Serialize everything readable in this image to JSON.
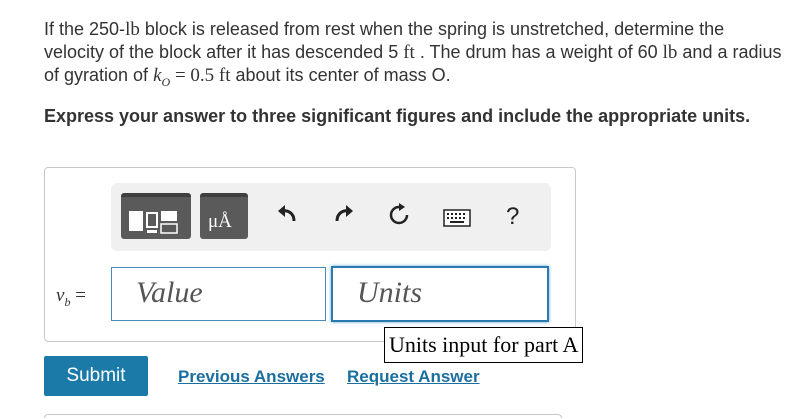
{
  "problem": {
    "text1": "If the 250-",
    "lb1": "lb",
    "text2": " block is released from rest when the spring is unstretched, determine the velocity of the block after it has descended 5 ",
    "ft1": "ft",
    "text3": " . The drum has a weight of 60 ",
    "lb2": "lb",
    "text4": " and a radius of gyration of ",
    "k": "k",
    "ksub": "O",
    "eq": " = 0.5 ",
    "ft2": "ft",
    "text5": " about its center of mass O."
  },
  "instruction": "Express your answer to three significant figures and include the appropriate units.",
  "toolbar": {
    "units_symbol": "μÅ",
    "help_label": "?"
  },
  "answer": {
    "var": "v",
    "var_sub": "b",
    "eq": " =",
    "value_placeholder": "Value",
    "units_placeholder": "Units",
    "tooltip": "Units input for part A"
  },
  "actions": {
    "submit": "Submit",
    "previous_answers": "Previous Answers",
    "request_answer": "Request Answer"
  },
  "colors": {
    "submit_bg": "#1b7aa8",
    "link": "#1b6fa0",
    "input_focus": "#2a7ab0"
  }
}
